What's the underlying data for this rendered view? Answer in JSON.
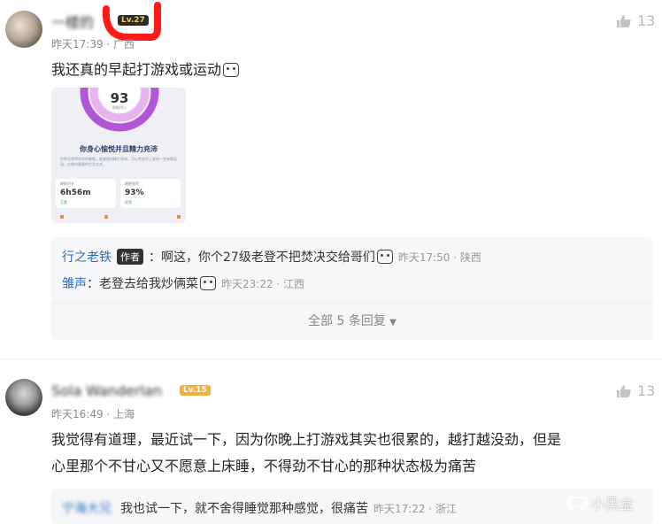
{
  "comments": [
    {
      "username": "一楼的",
      "level": "Lv.27",
      "time": "昨天17:39 · 广西",
      "likes": "13",
      "text": "我还真的早起打游戏或运动",
      "image": {
        "score": "93",
        "score_label": "睡眠得分",
        "headline": "你身心愉悦并且精力充沛",
        "desc": "你昨天获得优质的睡眠，能够保持精力充沛。可以考虑早上安排一些有氧运动，以维持健康的生活方式。",
        "stat1_label": "睡眠时长",
        "stat1_value": "6h56m",
        "stat1_tag": "正常",
        "stat2_label": "睡眠效率",
        "stat2_value": "93%",
        "stat2_tag": "优秀"
      },
      "replies": [
        {
          "name": "行之老铁",
          "tag": "作者",
          "text": "：啊这，你个27级老登不把焚决交给哥们",
          "meta": "昨天17:50 · 陕西"
        },
        {
          "name": "雏声",
          "text": "：老登去给我炒俩菜",
          "meta": "昨天23:22 · 江西"
        }
      ],
      "more": "全部 5 条回复"
    },
    {
      "username": "Sola Wanderlan",
      "level": "Lv.15",
      "time": "昨天16:49 · 上海",
      "likes": "13",
      "text_line1": "我觉得有道理，最近试一下，因为你晚上打游戏其实也很累的，越打越没劲，但是",
      "text_line2": "心里那个不甘心又不愿意上床睡，不得劲不甘心的那种状态极为痛苦",
      "replies": [
        {
          "name": "宁海大兄",
          "text": "我也试一下，就不舍得睡觉那种感觉，很痛苦",
          "meta": "昨天17:22 · 浙江"
        }
      ]
    }
  ],
  "watermark": "小黑盒"
}
